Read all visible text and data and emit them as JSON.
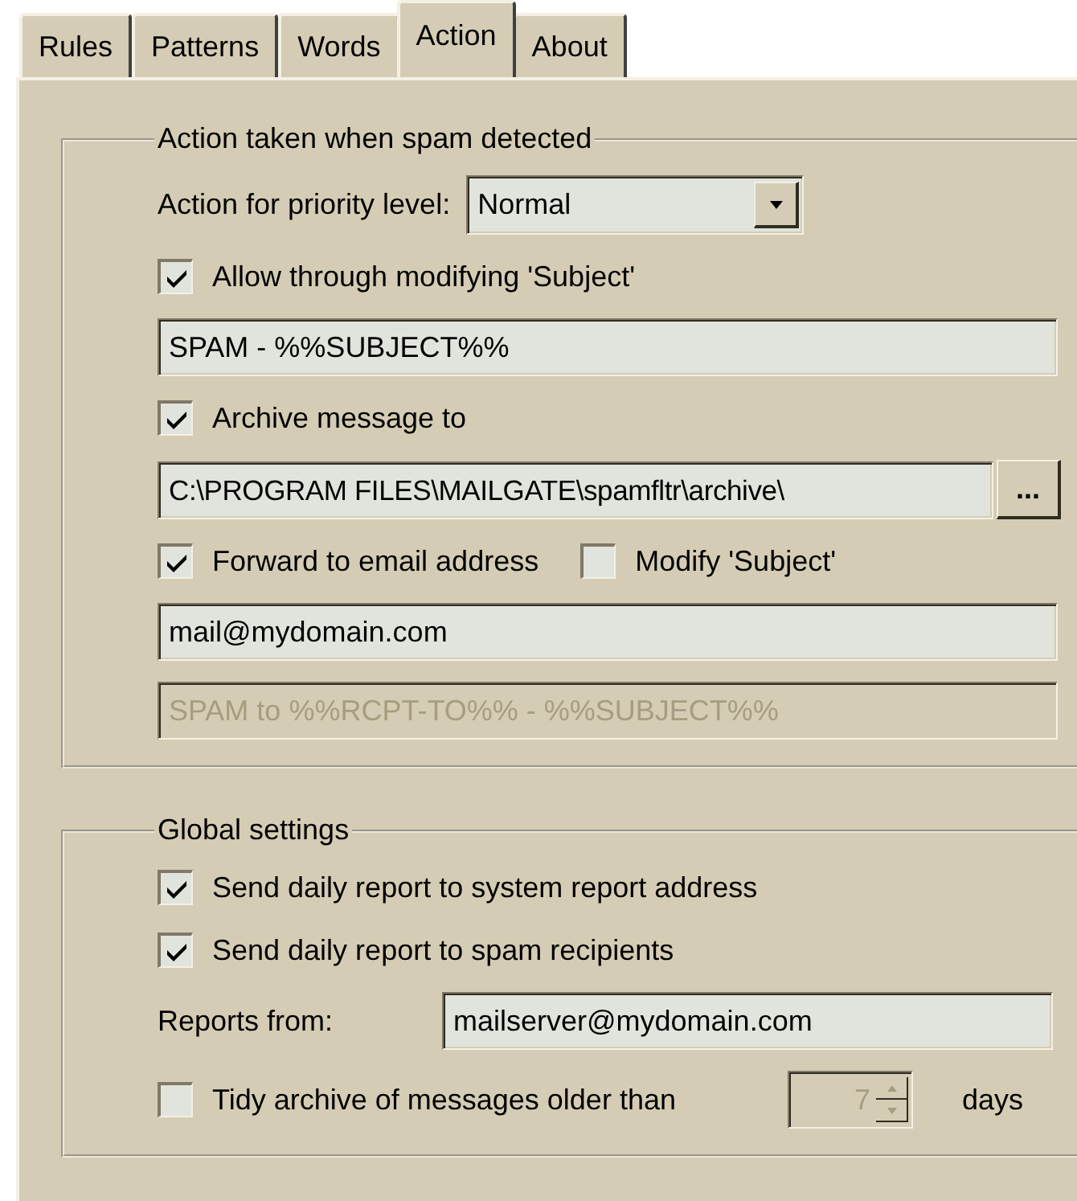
{
  "tabs": [
    {
      "label": "Rules",
      "selected": false
    },
    {
      "label": "Patterns",
      "selected": false
    },
    {
      "label": "Words",
      "selected": false
    },
    {
      "label": "Action",
      "selected": true
    },
    {
      "label": "About",
      "selected": false
    }
  ],
  "groups": [
    {
      "title": "Action taken when spam detected",
      "rows": [
        {
          "kind": "select",
          "label": "Action for priority level:",
          "value": "Normal"
        },
        {
          "kind": "checks",
          "items": [
            {
              "label": "Allow through modifying 'Subject'",
              "checked": true
            }
          ]
        },
        {
          "kind": "field",
          "value": "SPAM - %%SUBJECT%%",
          "disabled": false
        },
        {
          "kind": "checks",
          "items": [
            {
              "label": "Archive message to",
              "checked": true
            }
          ]
        },
        {
          "kind": "browse",
          "value": "C:\\PROGRAM FILES\\MAILGATE\\spamfltr\\archive\\",
          "button": "..."
        },
        {
          "kind": "checks",
          "items": [
            {
              "label": "Forward to email address",
              "checked": true
            },
            {
              "label": "Modify 'Subject'",
              "checked": false
            }
          ]
        },
        {
          "kind": "field",
          "value": "mail@mydomain.com",
          "disabled": false
        },
        {
          "kind": "field",
          "value": "SPAM to %%RCPT-TO%% - %%SUBJECT%%",
          "disabled": true
        }
      ]
    },
    {
      "title": "Global settings",
      "rows": [
        {
          "kind": "checks",
          "items": [
            {
              "label": "Send daily report to system report address",
              "checked": true
            }
          ]
        },
        {
          "kind": "checks",
          "items": [
            {
              "label": "Send daily report to spam recipients",
              "checked": true
            }
          ]
        },
        {
          "kind": "labeled_field",
          "label": "Reports from:",
          "value": "mailserver@mydomain.com"
        },
        {
          "kind": "spin",
          "label": "Tidy archive of messages older than",
          "checked": false,
          "value": "7",
          "unit": "days",
          "disabled": true
        }
      ]
    }
  ]
}
